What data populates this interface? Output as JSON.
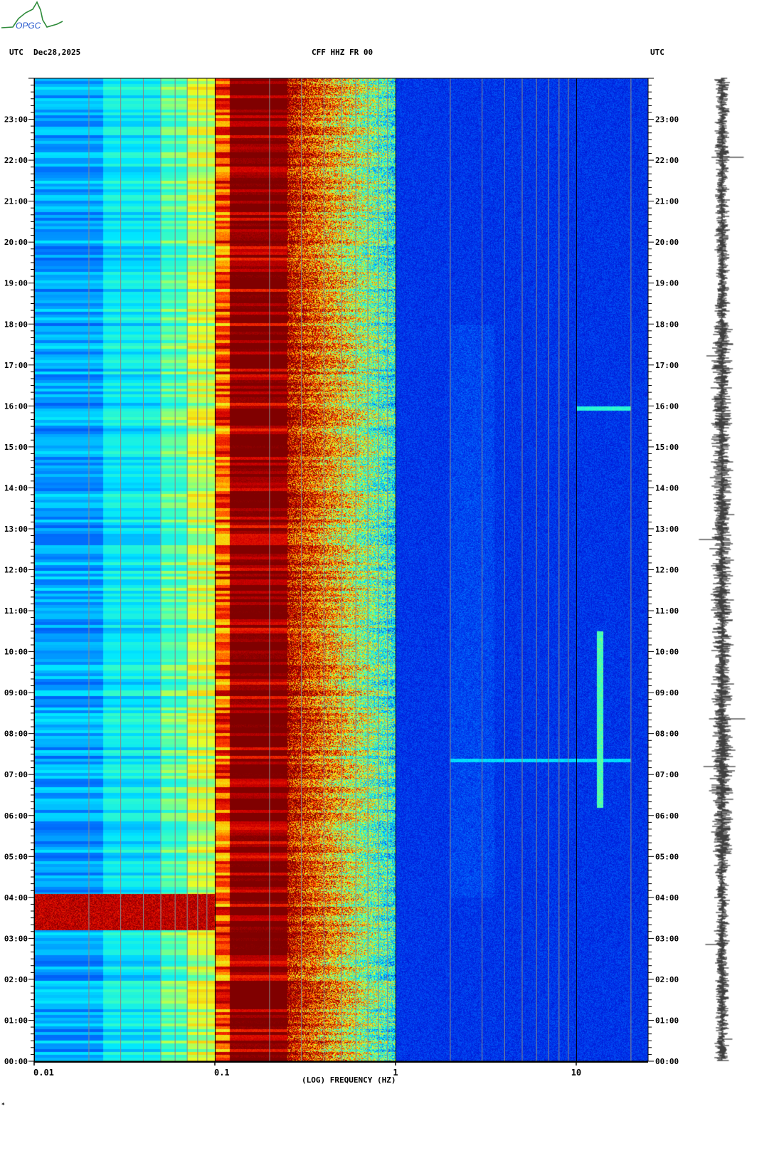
{
  "logo": {
    "text": "OPGC"
  },
  "header": {
    "left_tz": "UTC",
    "date": "Dec28,2025",
    "station": "CFF HHZ FR 00",
    "right_tz": "UTC"
  },
  "footer_mark": "*",
  "colors": {
    "low": "#0000c8",
    "mid": "#00ffff",
    "high": "#ffff00",
    "max": "#800000"
  },
  "chart_data": {
    "type": "heatmap",
    "title": "CFF HHZ FR 00",
    "xlabel": "(LOG) FREQUENCY (HZ)",
    "ylabel": "UTC",
    "xscale": "log",
    "xlim": [
      0.01,
      25
    ],
    "ylim_hours": [
      0,
      24
    ],
    "x_ticks": [
      {
        "value": 0.01,
        "label": "0.01"
      },
      {
        "value": 0.1,
        "label": "0.1"
      },
      {
        "value": 1,
        "label": "1"
      },
      {
        "value": 10,
        "label": "10"
      }
    ],
    "y_ticks": [
      "00:00",
      "01:00",
      "02:00",
      "03:00",
      "04:00",
      "05:00",
      "06:00",
      "07:00",
      "08:00",
      "09:00",
      "10:00",
      "11:00",
      "12:00",
      "13:00",
      "14:00",
      "15:00",
      "16:00",
      "17:00",
      "18:00",
      "19:00",
      "20:00",
      "21:00",
      "22:00",
      "23:00"
    ],
    "band_levels": [
      {
        "freq_range": [
          0.01,
          0.024
        ],
        "level": 0.3
      },
      {
        "freq_range": [
          0.024,
          0.05
        ],
        "level": 0.4
      },
      {
        "freq_range": [
          0.05,
          0.07
        ],
        "level": 0.5
      },
      {
        "freq_range": [
          0.07,
          0.1
        ],
        "level": 0.6
      },
      {
        "freq_range": [
          0.1,
          0.12
        ],
        "level": 0.8
      },
      {
        "freq_range": [
          0.12,
          0.25
        ],
        "level": 1.0
      },
      {
        "freq_range": [
          0.25,
          0.5
        ],
        "level": 0.8
      },
      {
        "freq_range": [
          0.5,
          0.8
        ],
        "level": 0.55
      },
      {
        "freq_range": [
          0.8,
          1.0
        ],
        "level": 0.3
      },
      {
        "freq_range": [
          1.0,
          25
        ],
        "level": 0.15
      }
    ],
    "events": [
      {
        "time_hours": [
          3.2,
          4.1
        ],
        "freq_range": [
          0.01,
          0.1
        ],
        "level": 1.0,
        "note": "low-frequency burst"
      },
      {
        "time_hours": [
          15.9,
          16.0
        ],
        "freq_range": [
          10,
          20
        ],
        "level": 0.5
      },
      {
        "time_hours": [
          7.3,
          7.4
        ],
        "freq_range": [
          2,
          20
        ],
        "level": 0.4
      },
      {
        "time_hours": [
          6.2,
          10.5
        ],
        "freq_range": [
          13,
          14
        ],
        "level": 0.55
      }
    ],
    "grid": true,
    "legend": "none",
    "trace": {
      "label": "seismogram",
      "placement": "right"
    }
  }
}
